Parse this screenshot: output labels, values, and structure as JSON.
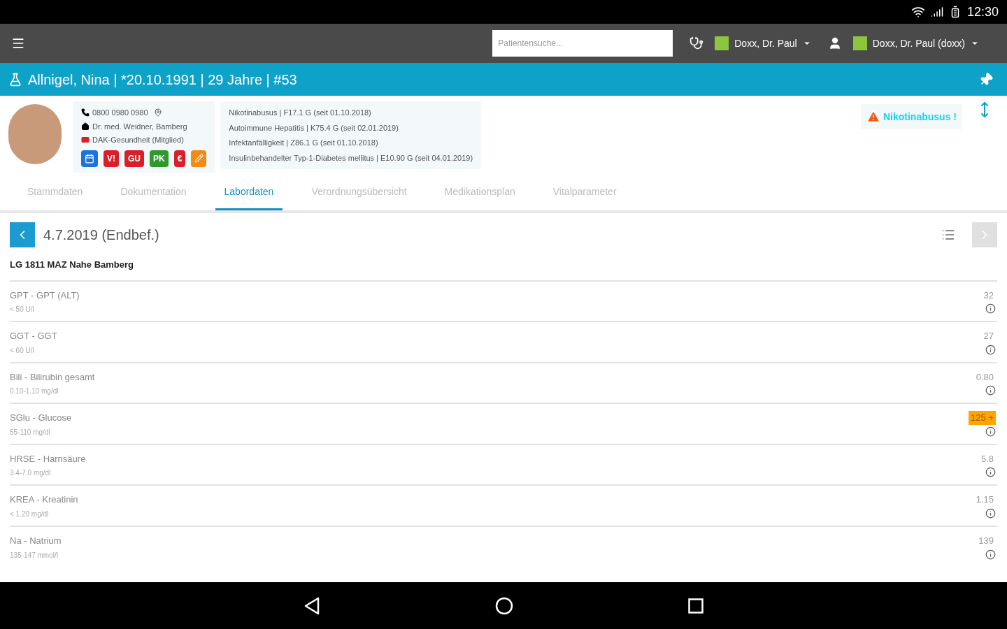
{
  "status_bar": {
    "time": "12:30"
  },
  "toolbar": {
    "search": {
      "placeholder": "Patientensuche..."
    },
    "users": [
      {
        "kind": "doctor",
        "name": "Doxx, Dr. Paul",
        "color": "#8cc63f"
      },
      {
        "kind": "person",
        "name": "Doxx, Dr. Paul (doxx)",
        "color": "#8cc63f"
      }
    ]
  },
  "patient": {
    "title": "Allnigel, Nina | *20.10.1991 | 29 Jahre | #53",
    "contact": [
      {
        "kind": "phone",
        "text": "0800 0980 0980"
      },
      {
        "kind": "doctor",
        "text": "Dr. med. Weidner, Bamberg"
      },
      {
        "kind": "insurance",
        "text": "DAK-Gesundheit (Mitglied)"
      }
    ],
    "badges": [
      {
        "kind": "calendar",
        "color": "#1e73d8"
      },
      {
        "kind": "text",
        "label": "V!",
        "color": "#d9202a"
      },
      {
        "kind": "text",
        "label": "GU",
        "color": "#d9202a"
      },
      {
        "kind": "text",
        "label": "PK",
        "color": "#2e9a2e"
      },
      {
        "kind": "text",
        "label": "€",
        "color": "#d9202a"
      },
      {
        "kind": "pen",
        "color": "#f28a1a"
      }
    ],
    "diagnoses": [
      "Nikotinabusus | F17.1 G (seit 01.10.2018)",
      "Autoimmune Hepatitis | K75.4 G (seit 02.01.2019)",
      "Infektanfälligkeit | Z86.1 G (seit 01.10.2018)",
      "Insulinbehandelter Typ-1-Diabetes mellitus | E10.90 G (seit 04.01.2019)"
    ],
    "warning": "Nikotinabusus !"
  },
  "tabs": [
    {
      "label": "Stammdaten",
      "selected": false
    },
    {
      "label": "Dokumentation",
      "selected": false
    },
    {
      "label": "Labordaten",
      "selected": true
    },
    {
      "label": "Verordnungsübersicht",
      "selected": false
    },
    {
      "label": "Medikationsplan",
      "selected": false
    },
    {
      "label": "Vitalparameter",
      "selected": false
    }
  ],
  "lab": {
    "date": "4.7.2019 (Endbef.)",
    "lab_name": "LG 1811 MAZ Nahe Bamberg",
    "rows": [
      {
        "name": "GPT - GPT (ALT)",
        "range": "< 50 U/l",
        "value": "32",
        "abnormal": false
      },
      {
        "name": "GGT - GGT",
        "range": "< 60 U/l",
        "value": "27",
        "abnormal": false
      },
      {
        "name": "Bili - Bilirubin gesamt",
        "range": "0.10-1.10 mg/dl",
        "value": "0.80",
        "abnormal": false
      },
      {
        "name": "SGlu - Glucose",
        "range": "55-110 mg/dl",
        "value": "125 +",
        "abnormal": true
      },
      {
        "name": "HRSE - Harnsäure",
        "range": "3.4-7.0 mg/dl",
        "value": "5.8",
        "abnormal": false
      },
      {
        "name": "KREA - Kreatinin",
        "range": "< 1.20 mg/dl",
        "value": "1.15",
        "abnormal": false
      },
      {
        "name": "Na - Natrium",
        "range": "135-147 mmol/l",
        "value": "139",
        "abnormal": false
      }
    ]
  }
}
